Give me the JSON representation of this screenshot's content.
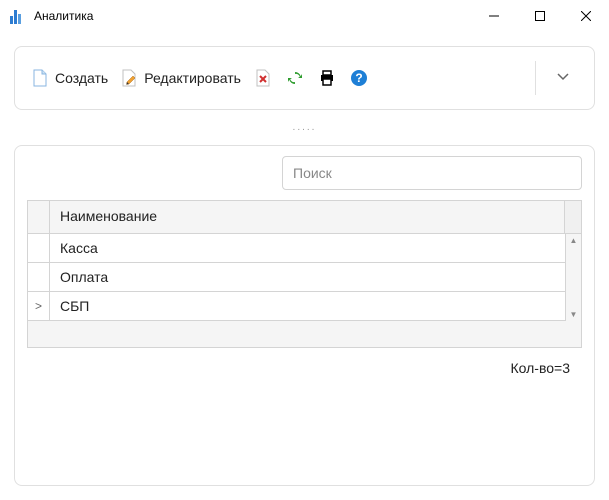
{
  "window": {
    "title": "Аналитика"
  },
  "toolbar": {
    "create_label": "Создать",
    "edit_label": "Редактировать"
  },
  "search": {
    "placeholder": "Поиск"
  },
  "grid": {
    "header": "Наименование",
    "rows": [
      {
        "name": "Касса",
        "expandable": false,
        "selected": false
      },
      {
        "name": "Оплата",
        "expandable": false,
        "selected": false
      },
      {
        "name": "СБП",
        "expandable": true,
        "selected": true
      }
    ],
    "count_label": "Кол-во=3"
  }
}
